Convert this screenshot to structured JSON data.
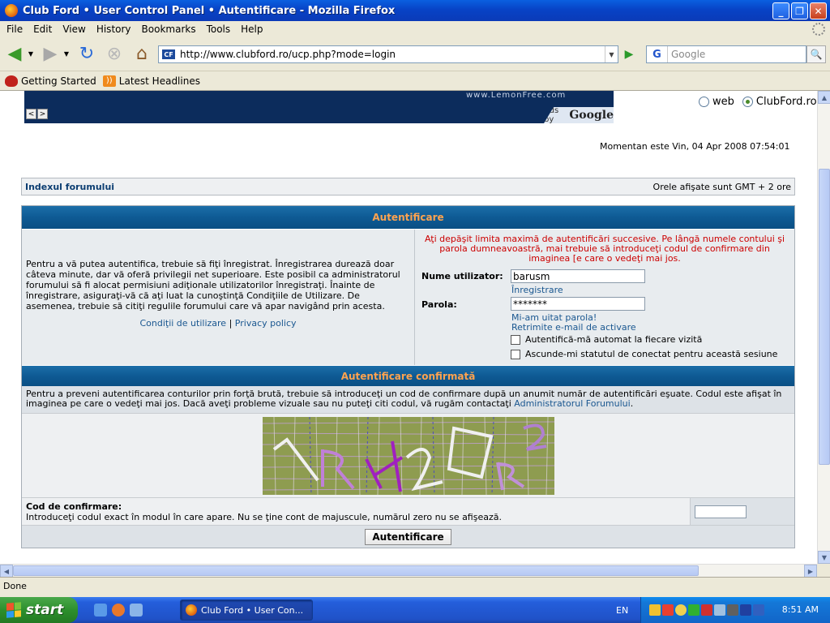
{
  "window": {
    "title": "Club Ford • User Control Panel • Autentificare - Mozilla Firefox"
  },
  "menu": [
    "File",
    "Edit",
    "View",
    "History",
    "Bookmarks",
    "Tools",
    "Help"
  ],
  "nav": {
    "url": "http://www.clubford.ro/ucp.php?mode=login",
    "site_icon_text": "CF",
    "search_engine_letter": "G",
    "search_placeholder": "Google"
  },
  "bookmarks": [
    "Getting Started",
    "Latest Headlines"
  ],
  "ad": {
    "url_text": "www.LemonFree.com",
    "prev": "<",
    "next": ">",
    "ads_by_prefix": "Ads by",
    "ads_by_brand": "Google"
  },
  "site_search": {
    "options": [
      "web",
      "ClubFord.ro"
    ],
    "selected": "ClubFord.ro"
  },
  "timestamp": "Momentan este Vin, 04 Apr 2008 07:54:01",
  "forum_nav": {
    "index_link": "Indexul forumului",
    "timezone": "Orele afişate sunt GMT + 2 ore"
  },
  "login": {
    "heading": "Autentificare",
    "intro": "Pentru a vă putea autentifica, trebuie să fiţi înregistrat. Înregistrarea durează doar câteva minute, dar vă oferă privilegii net superioare. Este posibil ca administratorul forumului să fi alocat permisiuni adiţionale utilizatorilor înregistraţi. Înainte de înregistrare, asiguraţi-vă că aţi luat la cunoştinţă Condiţiile de Utilizare. De asemenea, trebuie să citiţi regulile forumului care vă apar navigând prin acesta.",
    "terms_link": "Condiţii de utilizare",
    "separator": "|",
    "privacy_link": "Privacy policy",
    "error": "Aţi depăşit limita maximă de autentificări succesive. Pe lângă numele contului şi parola dumneavoastră, mai trebuie să introduceţi codul de confirmare din imaginea [e care o vedeţi mai jos.",
    "username_label": "Nume utilizator:",
    "username_value": "barusm",
    "register_link": "Înregistrare",
    "password_label": "Parola:",
    "password_value": "*******",
    "forgot_link": "Mi-am uitat parola!",
    "resend_link": "Retrimite e-mail de activare",
    "autologin_label": "Autentifică-mă automat la fiecare vizită",
    "hide_status_label": "Ascunde-mi statutul de conectat pentru această sesiune"
  },
  "confirm": {
    "heading": "Autentificare confirmată",
    "text": "Pentru a preveni autentificarea conturilor prin forţă brută, trebuie să introduceţi un cod de confirmare după un anumit număr de autentificări eşuate. Codul este afişat în imaginea pe care o vedeţi mai jos. Dacă aveţi probleme vizuale sau nu puteţi citi codul, vă rugăm contactaţi",
    "admin_link": "Administratorul Forumului",
    "end": ".",
    "code_label": "Cod de confirmare:",
    "code_hint": "Introduceţi codul exact în modul în care apare. Nu se ţine cont de majuscule, numărul zero nu se afişează.",
    "submit_label": "Autentificare"
  },
  "status": "Done",
  "taskbar": {
    "start_label": "start",
    "task_label": "Club Ford • User Con...",
    "language": "EN",
    "clock": "8:51 AM"
  }
}
